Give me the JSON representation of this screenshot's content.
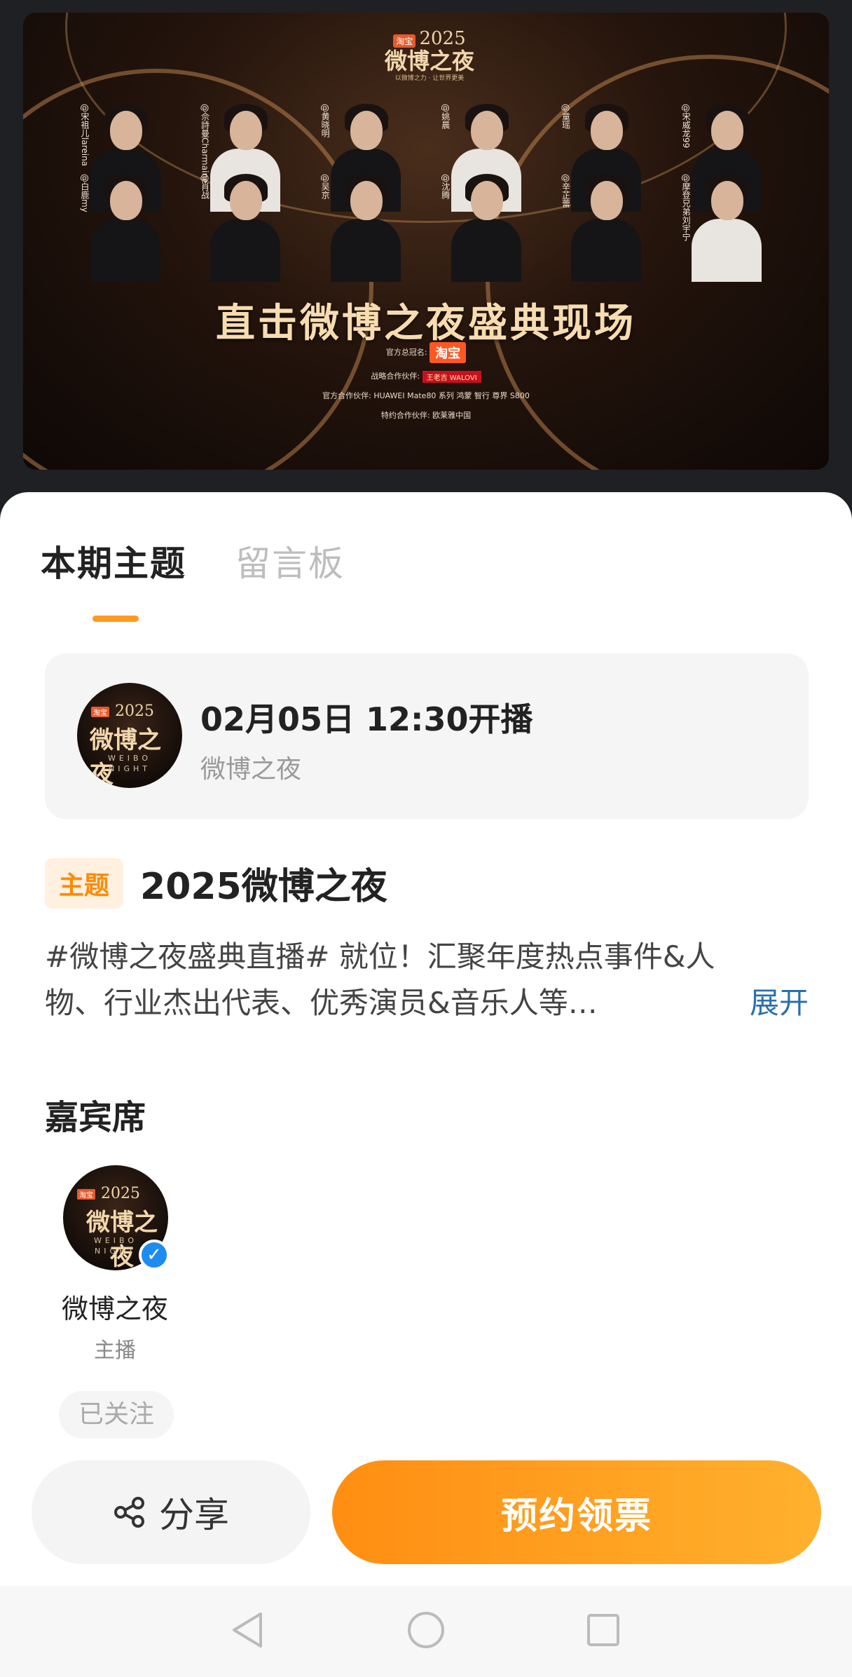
{
  "banner": {
    "logo_tb": "淘宝",
    "logo_year": "2025",
    "logo_name": "微博之夜",
    "logo_sub": "以微博之力 · 让世界更美",
    "row1": [
      "@宋祖儿lareina",
      "@佘詩曼Charmaine",
      "@黄晓明",
      "@姚晨",
      "@童瑶",
      "@宋威龙99"
    ],
    "row2": [
      "@白鹿my",
      "@肖战",
      "@吴京",
      "@沈腾",
      "@辛芷蕾",
      "@摩登兄弟刘宇宁"
    ],
    "headline": "直击微博之夜盛典现场",
    "sponsor1_label": "官方总冠名:",
    "sponsor1_value": "淘宝",
    "sponsor2_label": "战略合作伙伴:",
    "sponsor2_value": "王老吉 WALOVI",
    "sponsor3_label": "官方合作伙伴:",
    "sponsor3_value": "HUAWEI Mate80 系列   鸿蒙 智行 尊界 S800",
    "sponsor4_label": "特约合作伙伴:",
    "sponsor4_value": "欧莱雅中国"
  },
  "tabs": [
    {
      "label": "本期主题",
      "active": true
    },
    {
      "label": "留言板",
      "active": false
    }
  ],
  "live": {
    "avatar_tb": "淘宝",
    "avatar_year": "2025",
    "avatar_name": "微博之夜",
    "avatar_en1": "WEIBO",
    "avatar_en2": "NIGHT",
    "time": "02月05日 12:30开播",
    "host": "微博之夜"
  },
  "topic": {
    "badge": "主题",
    "title": "2025微博之夜",
    "desc_line1": "#微博之夜盛典直播# 就位！汇聚年度热点事件&人",
    "desc_line2": "物、行业杰出代表、优秀演员&音乐人等…",
    "expand": "展开"
  },
  "guests": {
    "title": "嘉宾席",
    "items": [
      {
        "name": "微博之夜",
        "role": "主播",
        "verified_icon": "verified-icon",
        "follow_label": "已关注"
      }
    ]
  },
  "actions": {
    "share_label": "分享",
    "ticket_label": "预约领票"
  },
  "colors": {
    "accent": "#ff9a1f",
    "link": "#2a6fb0",
    "verify": "#1d8cf0"
  }
}
